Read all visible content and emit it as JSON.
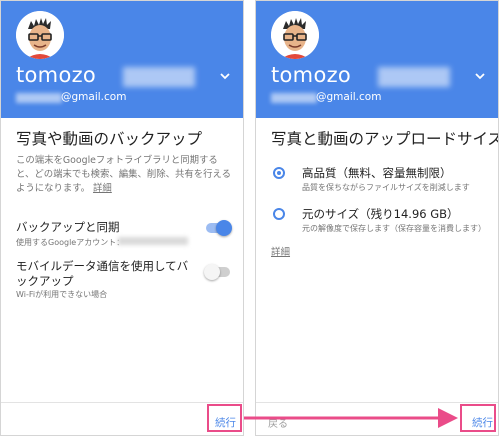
{
  "left": {
    "account": {
      "name": "tomozo",
      "email": "@gmail.com"
    },
    "title": "写真や動画のバックアップ",
    "description": "この端末をGoogleフォトライブラリと同期すると、どの端末でも検索、編集、削除、共有を行えるようになります。",
    "details_link": "詳細",
    "backup_sync": {
      "label": "バックアップと同期",
      "sub": "使用するGoogleアカウント：",
      "on": true
    },
    "mobile_data": {
      "label": "モバイルデータ通信を使用してバックアップ",
      "sub": "Wi-Fiが利用できない場合",
      "on": false
    },
    "continue_label": "続行"
  },
  "right": {
    "account": {
      "name": "tomozo",
      "email": "@gmail.com"
    },
    "title": "写真と動画のアップロードサイズ",
    "options": [
      {
        "label": "高品質（無料、容量無制限）",
        "sub": "品質を保ちながらファイルサイズを削減します",
        "selected": true
      },
      {
        "label": "元のサイズ（残り14.96 GB）",
        "sub": "元の解像度で保存します（保存容量を消費します）",
        "selected": false
      }
    ],
    "details_link": "詳細",
    "back_label": "戻る",
    "continue_label": "続行"
  },
  "colors": {
    "header": "#4a86e8",
    "accent": "#4a86e8",
    "highlight": "#ea4c89"
  }
}
